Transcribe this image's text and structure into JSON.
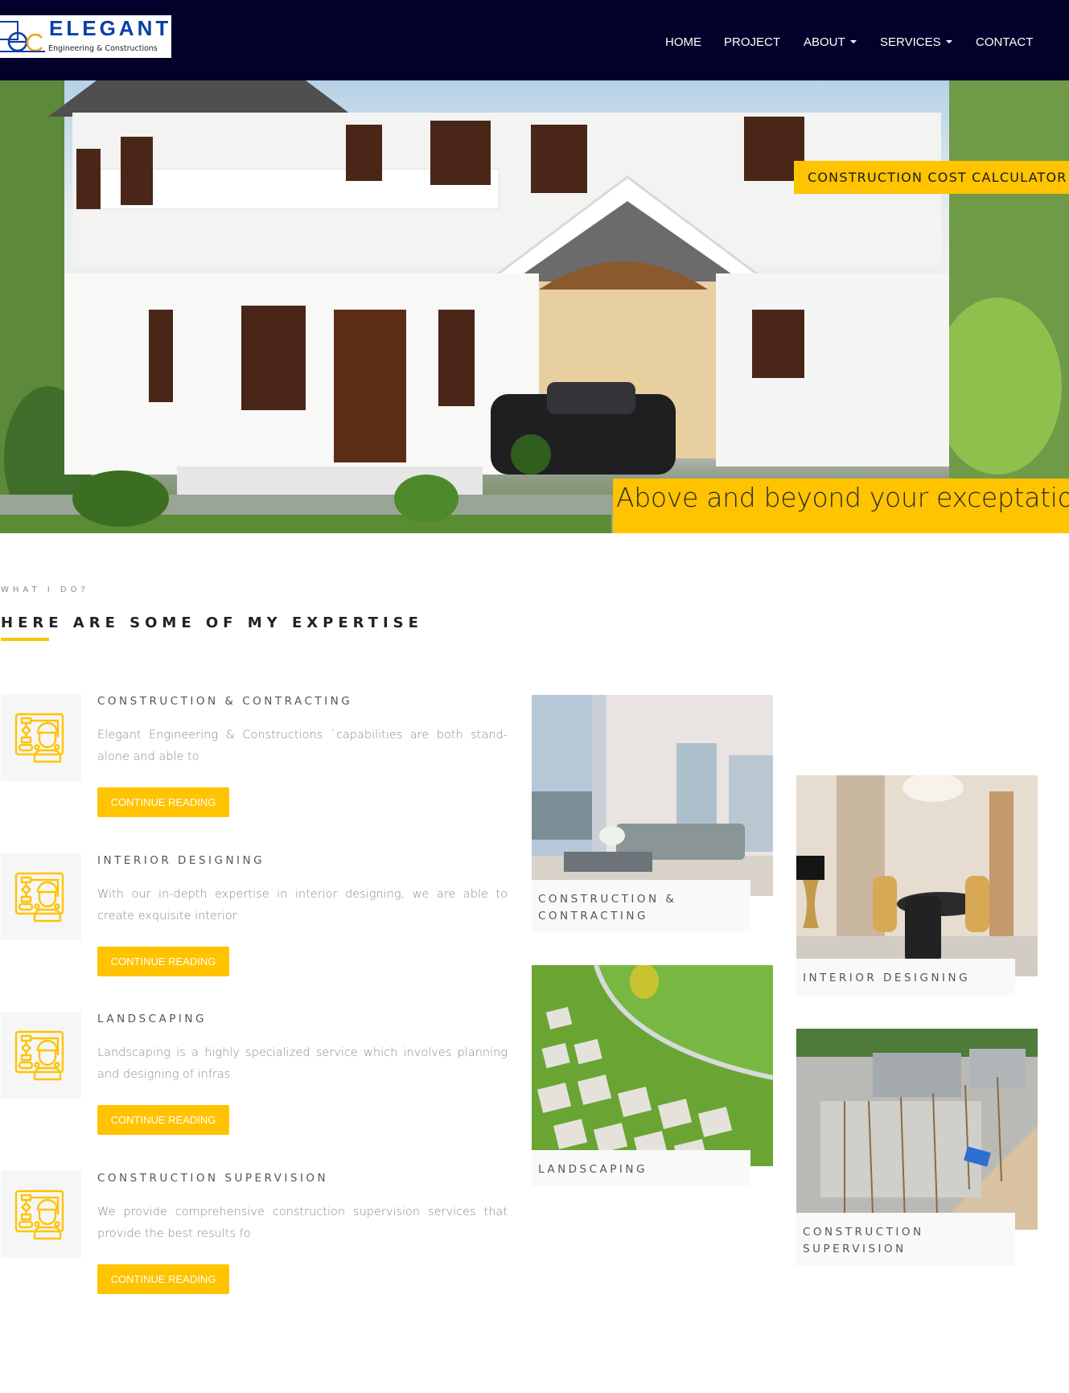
{
  "brand": {
    "name": "ELEGANT",
    "tagline": "Engineering & Constructions",
    "colors": {
      "primary_navy": "#01012a",
      "accent_yellow": "#ffc300",
      "logo_blue": "#0a3ea8",
      "logo_orange": "#f5a21a"
    }
  },
  "nav": {
    "items": [
      {
        "label": "HOME",
        "dropdown": false
      },
      {
        "label": "PROJECT",
        "dropdown": false
      },
      {
        "label": "ABOUT",
        "dropdown": true
      },
      {
        "label": "SERVICES",
        "dropdown": true
      },
      {
        "label": "CONTACT",
        "dropdown": false
      }
    ]
  },
  "hero": {
    "calculator_label": "CONSTRUCTION COST CALCULATOR",
    "tagline": "Above and beyond your exceptations",
    "image_icon": "house-photo"
  },
  "expertise": {
    "eyebrow": "WHAT I DO?",
    "title": "HERE ARE SOME OF MY EXPERTISE",
    "services": [
      {
        "title": "CONSTRUCTION & CONTRACTING",
        "description": "Elegant Engineering & Constructions `capabilities are both stand-alone and able to",
        "button": "CONTINUE READING",
        "icon": "engineer-blueprint-icon"
      },
      {
        "title": "INTERIOR DESIGNING",
        "description": "With our in-depth expertise in interior designing, we are able to create exquisite interior",
        "button": "CONTINUE READING",
        "icon": "engineer-blueprint-icon"
      },
      {
        "title": "LANDSCAPING",
        "description": "Landscaping is a highly specialized service which involves planning and designing of infras",
        "button": "CONTINUE READING",
        "icon": "engineer-blueprint-icon"
      },
      {
        "title": "CONSTRUCTION SUPERVISION",
        "description": "We provide comprehensive construction supervision services that provide the best results fo",
        "button": "CONTINUE READING",
        "icon": "engineer-blueprint-icon"
      }
    ]
  },
  "gallery": {
    "cards": [
      {
        "caption": "CONSTRUCTION & CONTRACTING",
        "image": "living-room-photo"
      },
      {
        "caption": "INTERIOR DESIGNING",
        "image": "dining-room-photo"
      },
      {
        "caption": "LANDSCAPING",
        "image": "grass-paving-photo"
      },
      {
        "caption": "CONSTRUCTION SUPERVISION",
        "image": "construction-site-photo"
      }
    ]
  }
}
